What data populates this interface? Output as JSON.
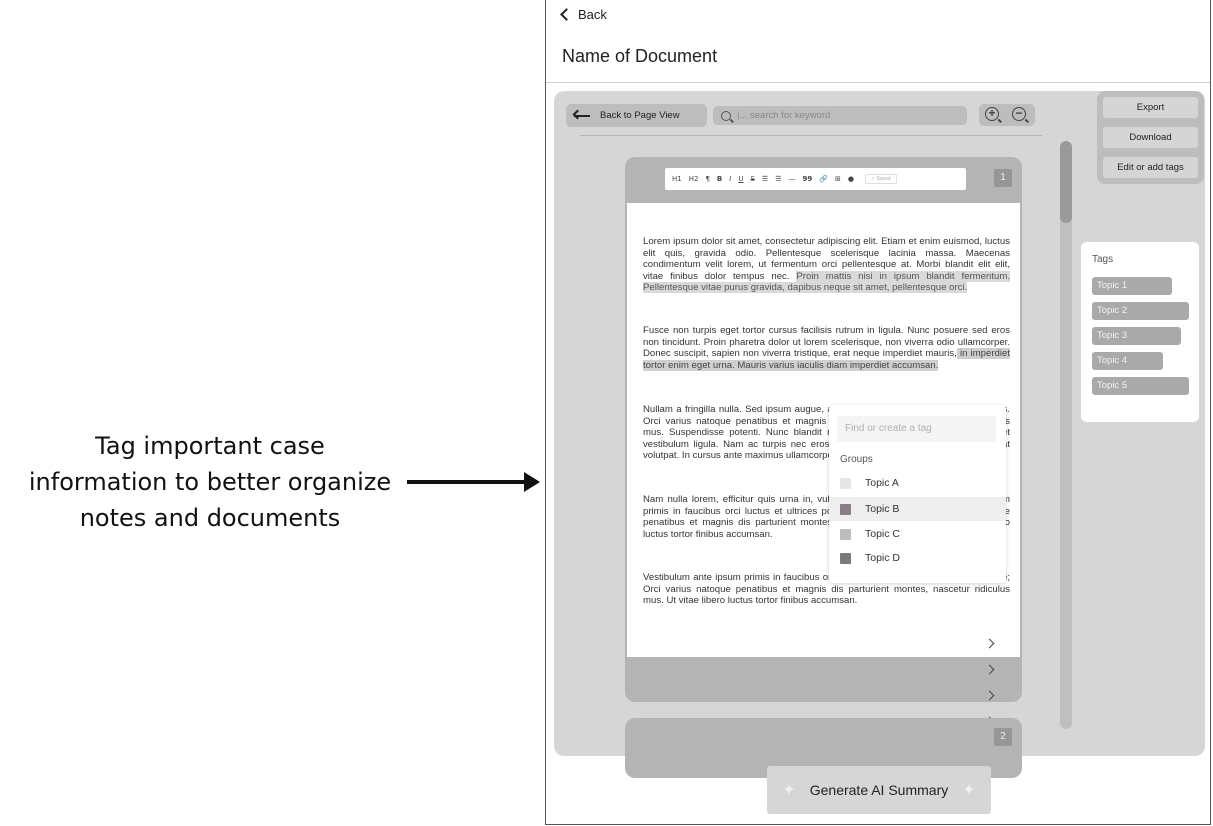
{
  "annotation": {
    "line1": "Tag important case",
    "line2": "information to better organize",
    "line3": "notes and documents"
  },
  "header": {
    "back_label": "Back",
    "title": "Name of Document"
  },
  "viewer": {
    "back_to_page_label": "Back to Page View",
    "search_placeholder": "|... search for keyword"
  },
  "actions": {
    "export": "Export",
    "download": "Download",
    "edit_tags": "Edit or add tags"
  },
  "tags": {
    "title": "Tags",
    "items": [
      "Topic 1",
      "Topic 2",
      "Topic 3",
      "Topic 4",
      "Topic 5"
    ]
  },
  "editor": {
    "toolbar": [
      "H1",
      "H2",
      "¶",
      "B",
      "I",
      "U",
      "S",
      "☰",
      "☰",
      "—",
      "99",
      "🔗",
      "⊞",
      "●"
    ],
    "saved_label": "✓ Saved",
    "page_numbers": [
      "1",
      "2"
    ]
  },
  "document": {
    "p1_a": "Lorem ipsum dolor sit amet, consectetur adipiscing elit. Etiam et enim euismod, luctus elit quis, gravida odio. Pellentesque scelerisque lacinia massa. Maecenas condimentum velit lorem, ut fermentum orci pellentesque at. Morbi blandit elit elit, vitae finibus dolor tempus nec. ",
    "p1_hl": "Proin mattis nisi in ipsum blandit fermentum. Pellentesque vitae purus gravida, dapibus neque sit amet, pellentesque orci.",
    "p2_a": "Fusce non turpis eget tortor cursus facilisis rutrum in ligula. Nunc posuere sed eros non tincidunt. Proin pharetra dolor ut lorem scelerisque, non viverra odio ullamcorper. Donec suscipit, sapien non viverra tristique, erat neque imperdiet mauris,",
    "p2_hl": " in imperdiet tortor enim eget urna. Mauris varius iaculis diam imperdiet accumsan.",
    "p3": "Nullam a fringilla nulla. Sed ipsum augue, aliquet non commodo vel, ultrices a tellus. Orci varius natoque penatibus et magnis dis parturient montes, nascetur ridiculus mus. Suspendisse potenti. Nunc blandit rutrum. Duis nec placerat eros, sit amet vestibulum ligula. Nam ac turpis nec eros luctus, sed sollicitudin elit. Aliquam erat volutpat. In cursus ante maximus ullamcorper.",
    "p4": "Nam nulla lorem, efficitur quis urna in, vulputate iaculis elit. Vestibulum ante ipsum primis in faucibus orci luctus et ultrices posuere cubilia curae; Orci varius natoque penatibus et magnis dis parturient montes, nascetur ridiculus mus. Ut vitae libero luctus tortor finibus accumsan.",
    "p5": "Vestibulum ante ipsum primis in faucibus orci luctus et ultrices posuere cubilia curae; Orci varius natoque penatibus et magnis dis parturient montes, nascetur ridiculus mus. Ut vitae libero luctus tortor finibus accumsan."
  },
  "tag_dropdown": {
    "placeholder": "Find or create a tag",
    "groups_label": "Groups",
    "options": [
      {
        "label": "Topic A",
        "color": "#e6e6e6"
      },
      {
        "label": "Topic B",
        "color": "#8a7d85",
        "selected": true
      },
      {
        "label": "Topic C",
        "color": "#bdbdbd"
      },
      {
        "label": "Topic D",
        "color": "#7a7a7a"
      }
    ]
  },
  "footer": {
    "generate_label": "Generate AI Summary"
  }
}
